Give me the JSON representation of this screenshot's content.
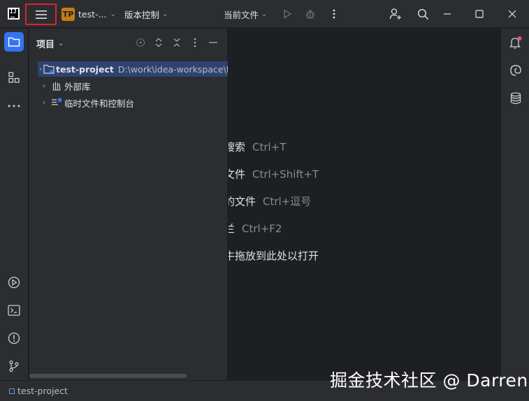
{
  "titlebar": {
    "project_badge": "TP",
    "project_name": "test-...",
    "vcs_label": "版本控制",
    "run_config": "当前文件"
  },
  "icons": {
    "main_menu": "hamburger-menu-icon",
    "run": "play-icon",
    "debug": "bug-icon",
    "more": "more-vertical-icon",
    "add_user": "add-user-icon",
    "search": "search-icon",
    "minimize": "minimize-icon",
    "maximize": "maximize-icon",
    "close": "close-icon"
  },
  "project_panel": {
    "title": "项目",
    "tree": [
      {
        "name": "test-project",
        "path": "D:\\work\\idea-workspace\\te",
        "selected": true
      },
      {
        "name": "外部库",
        "path": "",
        "selected": false
      },
      {
        "name": "临时文件和控制台",
        "path": "",
        "selected": false
      }
    ]
  },
  "editor_hints": [
    {
      "text": "搜索",
      "shortcut": "Ctrl+T"
    },
    {
      "text": "文件",
      "shortcut": "Ctrl+Shift+T"
    },
    {
      "text": "的文件",
      "shortcut": "Ctrl+逗号"
    },
    {
      "text": "兰",
      "shortcut": "Ctrl+F2"
    },
    {
      "text": "牛拖放到此处以打开",
      "shortcut": ""
    }
  ],
  "statusbar": {
    "project": "test-project"
  },
  "watermark": "掘金技术社区 @ Darren",
  "colors": {
    "accent": "#3574f0",
    "highlight_border": "#d8262d",
    "badge": "#c57c14",
    "notification_dot": "#e55765"
  }
}
